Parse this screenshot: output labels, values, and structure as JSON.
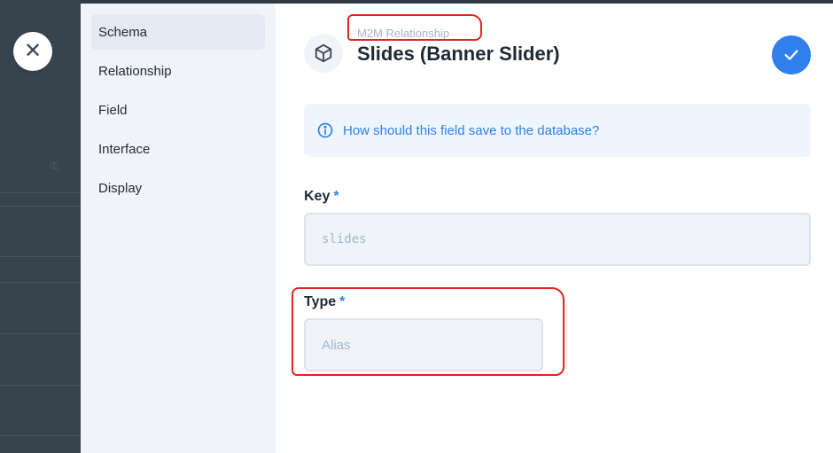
{
  "drawer": {
    "close_icon": "close-icon",
    "nav": [
      "Schema",
      "Relationship",
      "Field",
      "Interface",
      "Display"
    ],
    "active_nav": "Schema"
  },
  "header": {
    "subtitle": "M2M Relationship",
    "title": "Slides (Banner Slider)",
    "icon": "cube-icon",
    "save_icon": "check-icon"
  },
  "notice": {
    "text": "How should this field save to the database?",
    "icon": "info-icon"
  },
  "key_field": {
    "label": "Key",
    "required_mark": "*",
    "value": "slides"
  },
  "type_field": {
    "label": "Type",
    "required_mark": "*",
    "value": "Alias"
  },
  "colors": {
    "accent": "#2f80ed",
    "annotation": "#e0251e"
  }
}
